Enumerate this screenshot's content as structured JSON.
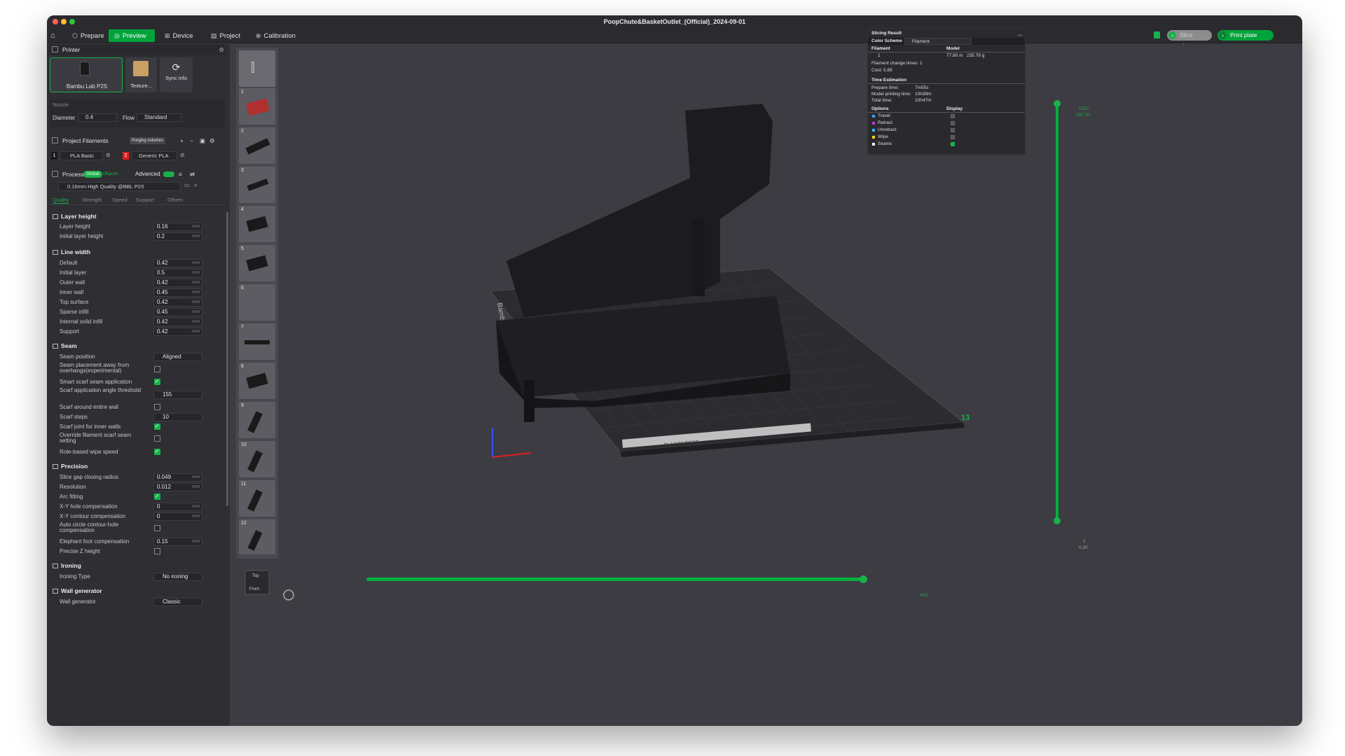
{
  "window": {
    "title": "PoopChute&BasketOutlet_(Official)_2024-09-01"
  },
  "nav": {
    "prepare": "Prepare",
    "preview": "Preview",
    "device": "Device",
    "project": "Project",
    "calibration": "Calibration",
    "slice_plate": "Slice plate",
    "print_plate": "Print plate"
  },
  "printer": {
    "section_title": "Printer",
    "printer_name": "Bambu Lab P2S",
    "plate_name": "Texture...",
    "sync_label": "Sync info",
    "nozzle_label": "Nozzle",
    "diameter_label": "Diameter",
    "diameter_value": "0.4",
    "flow_label": "Flow",
    "flow_value": "Standard"
  },
  "filaments": {
    "section_title": "Project Filaments",
    "purging_label": "Purging volumes",
    "items": [
      {
        "index": "1",
        "name": "PLA Basic"
      },
      {
        "index": "2",
        "name": "Generic PLA"
      }
    ]
  },
  "process": {
    "section_title": "Process",
    "global_label": "Global",
    "objects_label": "Objects",
    "advanced_label": "Advanced",
    "preset": "0.16mm High Quality @BBL P2S",
    "tabs": [
      "Quality",
      "Strength",
      "Speed",
      "Support",
      "Others"
    ]
  },
  "quality": {
    "layer_height_title": "Layer height",
    "layer_height_label": "Layer height",
    "layer_height_value": "0.16",
    "initial_layer_height_label": "Initial layer height",
    "initial_layer_height_value": "0.2",
    "unit": "mm",
    "line_width_title": "Line width",
    "line_widths": [
      {
        "label": "Default",
        "value": "0.42"
      },
      {
        "label": "Initial layer",
        "value": "0.5"
      },
      {
        "label": "Outer wall",
        "value": "0.42"
      },
      {
        "label": "Inner wall",
        "value": "0.45"
      },
      {
        "label": "Top surface",
        "value": "0.42"
      },
      {
        "label": "Sparse infill",
        "value": "0.45"
      },
      {
        "label": "Internal solid infill",
        "value": "0.42"
      },
      {
        "label": "Support",
        "value": "0.42"
      }
    ],
    "seam_title": "Seam",
    "seam_position_label": "Seam position",
    "seam_position_value": "Aligned",
    "seam_away_label": "Seam placement away from overhangs(experimental)",
    "smart_scarf_label": "Smart scarf seam application",
    "scarf_angle_label": "Scarf application angle threshold",
    "scarf_angle_value": "155",
    "scarf_entire_label": "Scarf around entire wall",
    "scarf_steps_label": "Scarf steps",
    "scarf_steps_value": "10",
    "scarf_inner_label": "Scarf joint for inner walls",
    "override_scarf_label": "Override filament scarf seam setting",
    "role_wipe_label": "Role-based wipe speed",
    "precision_title": "Precision",
    "slice_gap_label": "Slice gap closing radius",
    "slice_gap_value": "0.049",
    "resolution_label": "Resolution",
    "resolution_value": "0.012",
    "arc_fitting_label": "Arc fitting",
    "xy_hole_label": "X-Y hole compensation",
    "xy_hole_value": "0",
    "xy_contour_label": "X-Y contour compensation",
    "xy_contour_value": "0",
    "auto_circle_label": "Auto circle contour-hole compensation",
    "elephant_label": "Elephant foot compensation",
    "elephant_value": "0.15",
    "precise_z_label": "Precise Z height",
    "ironing_title": "Ironing",
    "ironing_type_label": "Ironing Type",
    "ironing_type_value": "No ironing",
    "wall_gen_title": "Wall generator",
    "wall_gen_label": "Wall generator",
    "wall_gen_value": "Classic"
  },
  "plates": [
    "1",
    "2",
    "3",
    "4",
    "5",
    "6",
    "7",
    "8",
    "9",
    "10",
    "11",
    "12"
  ],
  "viewport": {
    "bed_label_left": "Bambu T",
    "bed_plate_number": "13",
    "bed_text": "PLA/ABS/PETG",
    "view_cube_top": "Top",
    "view_cube_front": "Front",
    "vslider_top": "1257",
    "vslider_top2": "197.00",
    "vslider_bottom": "1",
    "vslider_bottom2": "0.20",
    "hslider_value": "415"
  },
  "slicing": {
    "title": "Slicing Result",
    "color_scheme_label": "Color Scheme",
    "color_scheme_value": "Filament",
    "filament_header": "Filament",
    "model_header": "Model",
    "filament_index": "1",
    "filament_length": "77.80 m",
    "filament_weight": "235.79 g",
    "change_times": "Filament change times:  1",
    "cost": "Cost:  5.89",
    "time_title": "Time Estimation",
    "prepare_label": "Prepare time:",
    "prepare_value": "7m55s",
    "model_time_label": "Model printing time:",
    "model_time_value": "10h39m",
    "total_label": "Total time:",
    "total_value": "10h47m",
    "options_header": "Options",
    "display_header": "Display",
    "options": [
      {
        "label": "Travel",
        "color": "#3aa0ff"
      },
      {
        "label": "Retract",
        "color": "#c238d6"
      },
      {
        "label": "Unretract",
        "color": "#39b8f0"
      },
      {
        "label": "Wipe",
        "color": "#f2d31b"
      },
      {
        "label": "Seams",
        "color": "#f0f0f0"
      }
    ]
  },
  "colors": {
    "accent": "#00a33a",
    "filament2": "#e0201b"
  }
}
